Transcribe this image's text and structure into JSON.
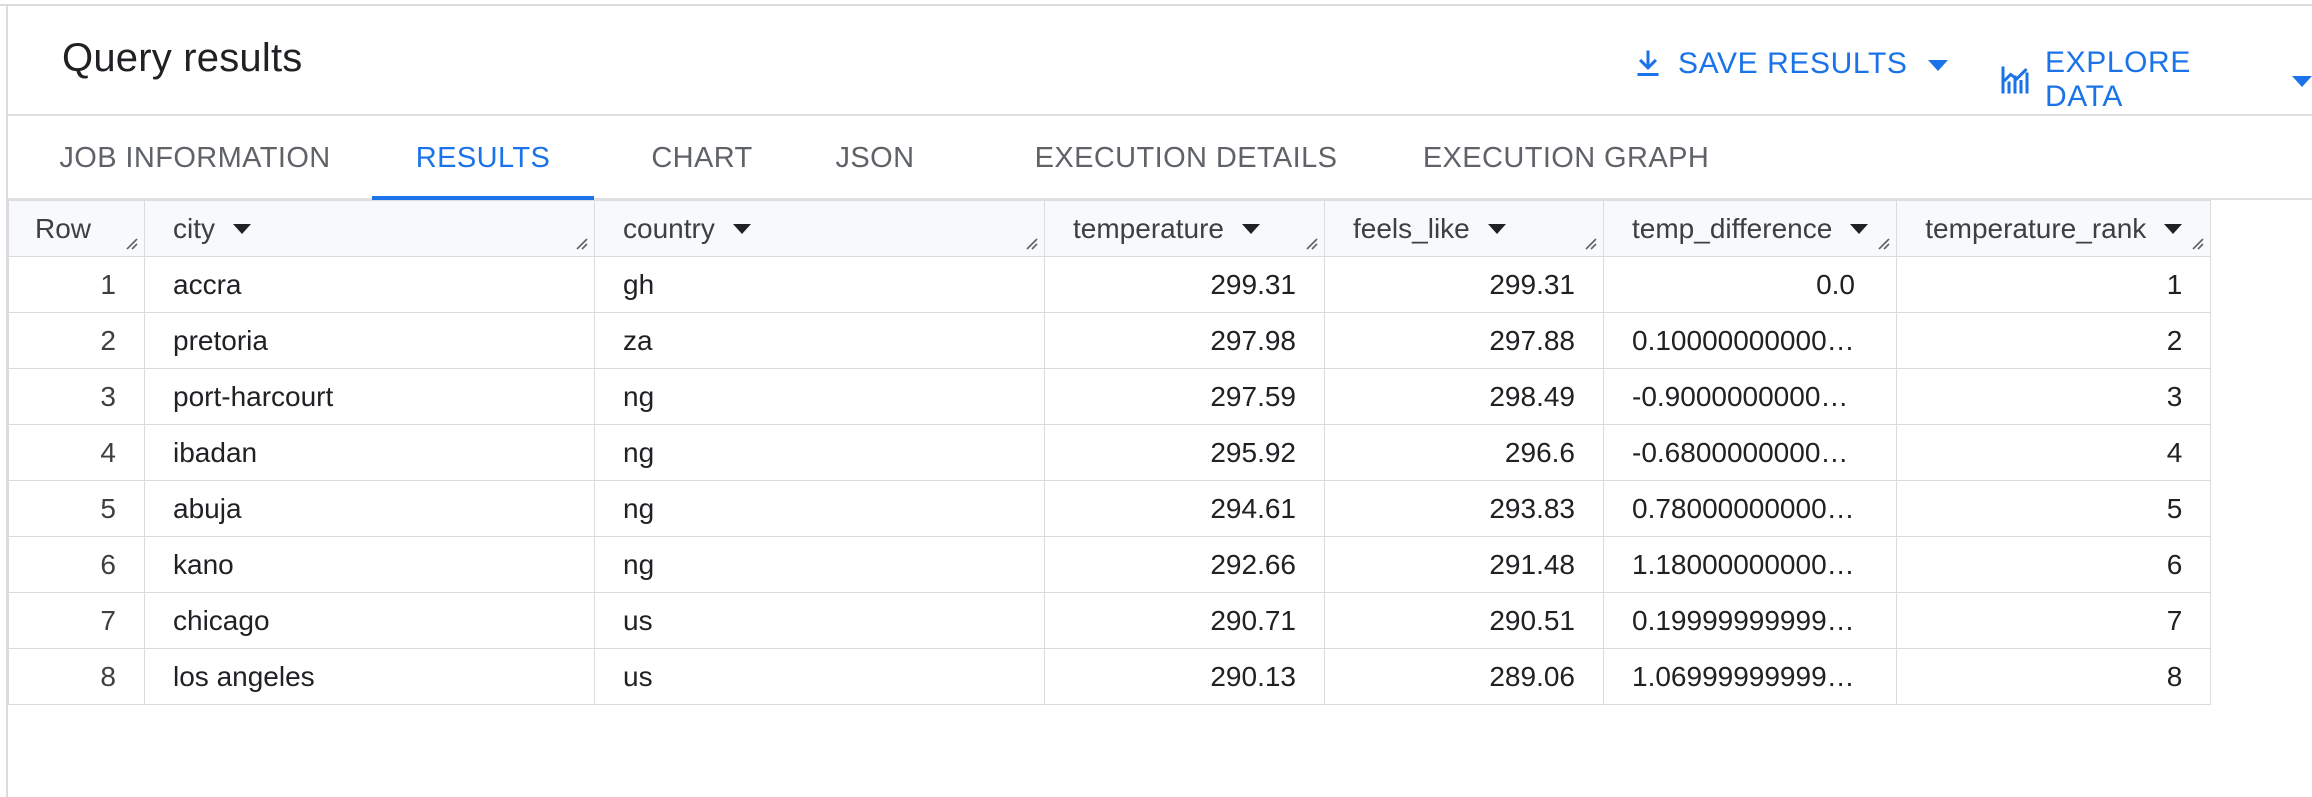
{
  "header": {
    "title": "Query results",
    "save_label": "SAVE RESULTS",
    "explore_label": "EXPLORE DATA"
  },
  "colors": {
    "accent": "#1a73e8",
    "border": "#dadce0",
    "header_bg": "#f8f9fa",
    "text": "#202124"
  },
  "tabs": [
    {
      "label": "JOB INFORMATION",
      "active": false
    },
    {
      "label": "RESULTS",
      "active": true
    },
    {
      "label": "CHART",
      "active": false
    },
    {
      "label": "JSON",
      "active": false
    },
    {
      "label": "EXECUTION DETAILS",
      "active": false
    },
    {
      "label": "EXECUTION GRAPH",
      "active": false
    }
  ],
  "table": {
    "columns": [
      "Row",
      "city",
      "country",
      "temperature",
      "feels_like",
      "temp_difference",
      "temperature_rank"
    ],
    "rows": [
      {
        "row": "1",
        "city": "accra",
        "country": "gh",
        "temperature": "299.31",
        "feels_like": "299.31",
        "temp_difference": "0.0",
        "temperature_rank": "1"
      },
      {
        "row": "2",
        "city": "pretoria",
        "country": "za",
        "temperature": "297.98",
        "feels_like": "297.88",
        "temp_difference": "0.100000000000…",
        "temperature_rank": "2"
      },
      {
        "row": "3",
        "city": "port-harcourt",
        "country": "ng",
        "temperature": "297.59",
        "feels_like": "298.49",
        "temp_difference": "-0.90000000000…",
        "temperature_rank": "3"
      },
      {
        "row": "4",
        "city": "ibadan",
        "country": "ng",
        "temperature": "295.92",
        "feels_like": "296.6",
        "temp_difference": "-0.68000000000…",
        "temperature_rank": "4"
      },
      {
        "row": "5",
        "city": "abuja",
        "country": "ng",
        "temperature": "294.61",
        "feels_like": "293.83",
        "temp_difference": "0.780000000000…",
        "temperature_rank": "5"
      },
      {
        "row": "6",
        "city": "kano",
        "country": "ng",
        "temperature": "292.66",
        "feels_like": "291.48",
        "temp_difference": "1.180000000000…",
        "temperature_rank": "6"
      },
      {
        "row": "7",
        "city": "chicago",
        "country": "us",
        "temperature": "290.71",
        "feels_like": "290.51",
        "temp_difference": "0.199999999999…",
        "temperature_rank": "7"
      },
      {
        "row": "8",
        "city": "los angeles",
        "country": "us",
        "temperature": "290.13",
        "feels_like": "289.06",
        "temp_difference": "1.069999999999…",
        "temperature_rank": "8"
      }
    ]
  }
}
